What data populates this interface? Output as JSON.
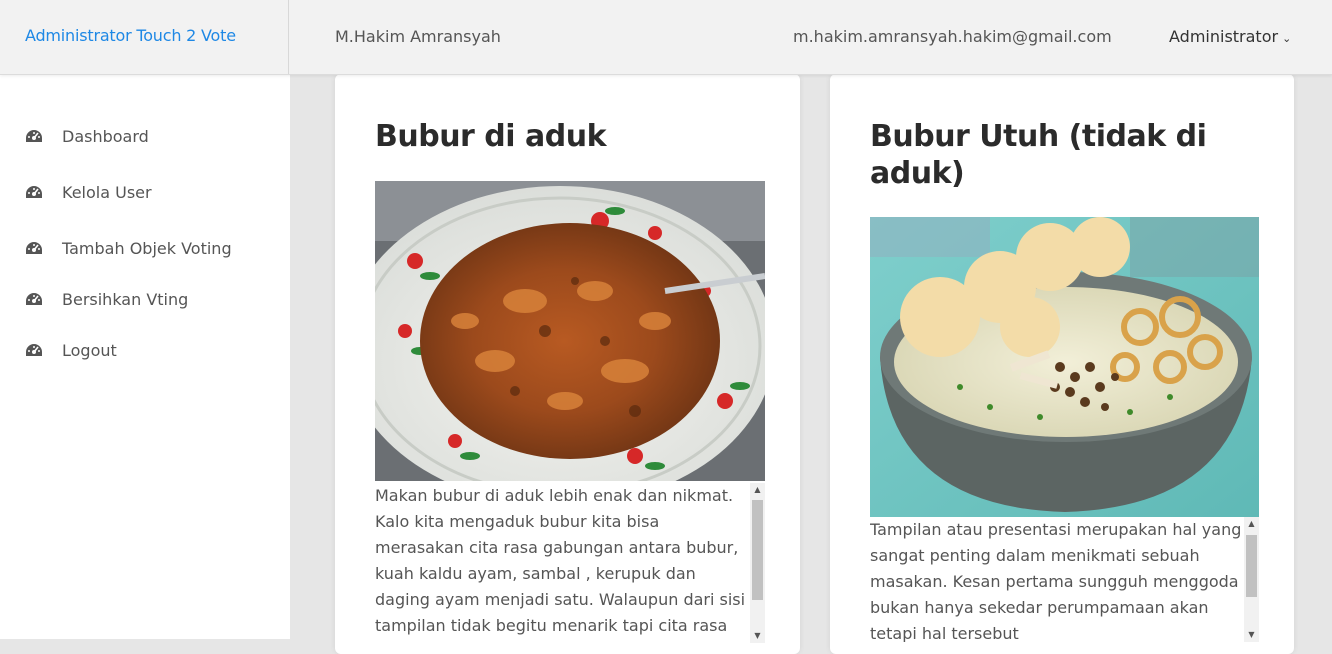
{
  "header": {
    "brand": "Administrator Touch 2 Vote",
    "user_name": "M.Hakim Amransyah",
    "email": "m.hakim.amransyah.hakim@gmail.com",
    "role_menu": "Administrator",
    "role_caret": "⌄"
  },
  "sidebar": {
    "items": [
      {
        "label": "Dashboard",
        "icon": "dashboard-gauge-icon"
      },
      {
        "label": "Kelola User",
        "icon": "dashboard-gauge-icon"
      },
      {
        "label": "Tambah Objek Voting",
        "icon": "dashboard-gauge-icon"
      },
      {
        "label": "Bersihkan Vting",
        "icon": "dashboard-gauge-icon"
      },
      {
        "label": "Logout",
        "icon": "dashboard-gauge-icon"
      }
    ]
  },
  "cards": [
    {
      "title": "Bubur di aduk",
      "image": "mixed-porridge-photo",
      "description": "Makan bubur di aduk lebih enak dan nikmat. Kalo kita mengaduk bubur kita bisa merasakan cita rasa gabungan antara bubur, kuah kaldu ayam, sambal , kerupuk dan daging ayam menjadi satu. Walaupun dari sisi tampilan tidak begitu menarik tapi cita rasa"
    },
    {
      "title": "Bubur Utuh (tidak di aduk)",
      "image": "unmixed-porridge-photo",
      "description": "Tampilan atau presentasi merupakan hal yang sangat penting dalam menikmati sebuah masakan. Kesan pertama sungguh menggoda bukan hanya sekedar perumpamaan akan tetapi hal tersebut"
    }
  ],
  "scroll_arrows": {
    "up": "▲",
    "down": "▼"
  },
  "colors": {
    "brand": "#1e88e5",
    "background": "#e6e6e6",
    "topbar": "#f2f2f2",
    "card": "#ffffff"
  }
}
